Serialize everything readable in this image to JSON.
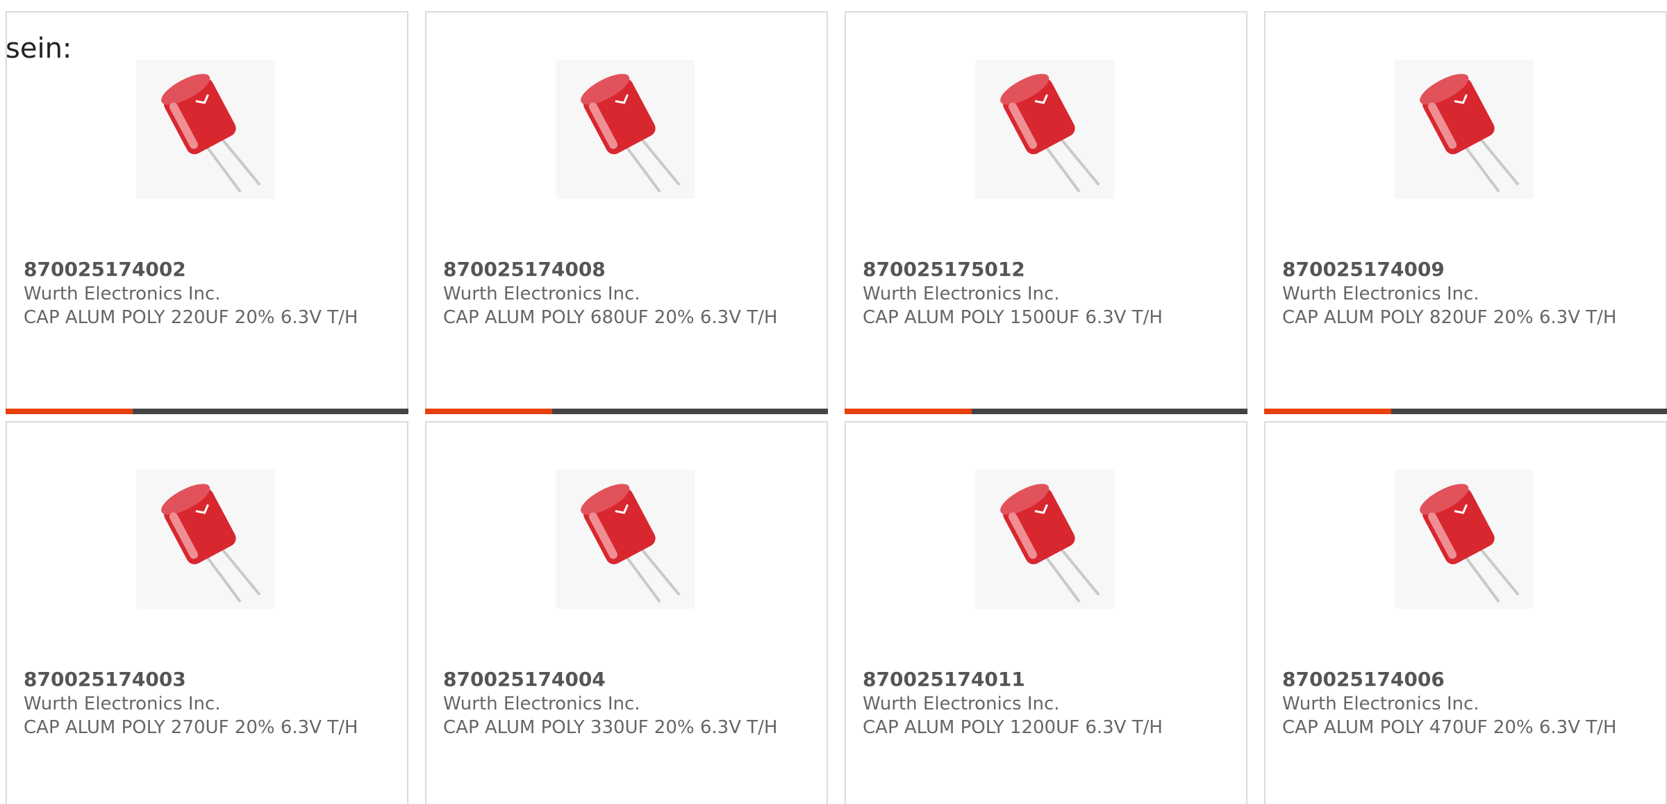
{
  "intro_text": "sein:",
  "colors": {
    "accent": "#e8400d",
    "bar": "#444444",
    "border": "#dcdcdc",
    "capacitor": "#d8272f"
  },
  "products": [
    {
      "part_number": "870025174002",
      "manufacturer": "Wurth Electronics Inc.",
      "description": "CAP ALUM POLY 220UF 20% 6.3V T/H",
      "image": "capacitor-icon"
    },
    {
      "part_number": "870025174008",
      "manufacturer": "Wurth Electronics Inc.",
      "description": "CAP ALUM POLY 680UF 20% 6.3V T/H",
      "image": "capacitor-icon"
    },
    {
      "part_number": "870025175012",
      "manufacturer": "Wurth Electronics Inc.",
      "description": "CAP ALUM POLY 1500UF 6.3V T/H",
      "image": "capacitor-icon"
    },
    {
      "part_number": "870025174009",
      "manufacturer": "Wurth Electronics Inc.",
      "description": "CAP ALUM POLY 820UF 20% 6.3V T/H",
      "image": "capacitor-icon"
    },
    {
      "part_number": "870025174003",
      "manufacturer": "Wurth Electronics Inc.",
      "description": "CAP ALUM POLY 270UF 20% 6.3V T/H",
      "image": "capacitor-icon"
    },
    {
      "part_number": "870025174004",
      "manufacturer": "Wurth Electronics Inc.",
      "description": "CAP ALUM POLY 330UF 20% 6.3V T/H",
      "image": "capacitor-icon"
    },
    {
      "part_number": "870025174011",
      "manufacturer": "Wurth Electronics Inc.",
      "description": "CAP ALUM POLY 1200UF 6.3V T/H",
      "image": "capacitor-icon"
    },
    {
      "part_number": "870025174006",
      "manufacturer": "Wurth Electronics Inc.",
      "description": "CAP ALUM POLY 470UF 20% 6.3V T/H",
      "image": "capacitor-icon"
    }
  ]
}
